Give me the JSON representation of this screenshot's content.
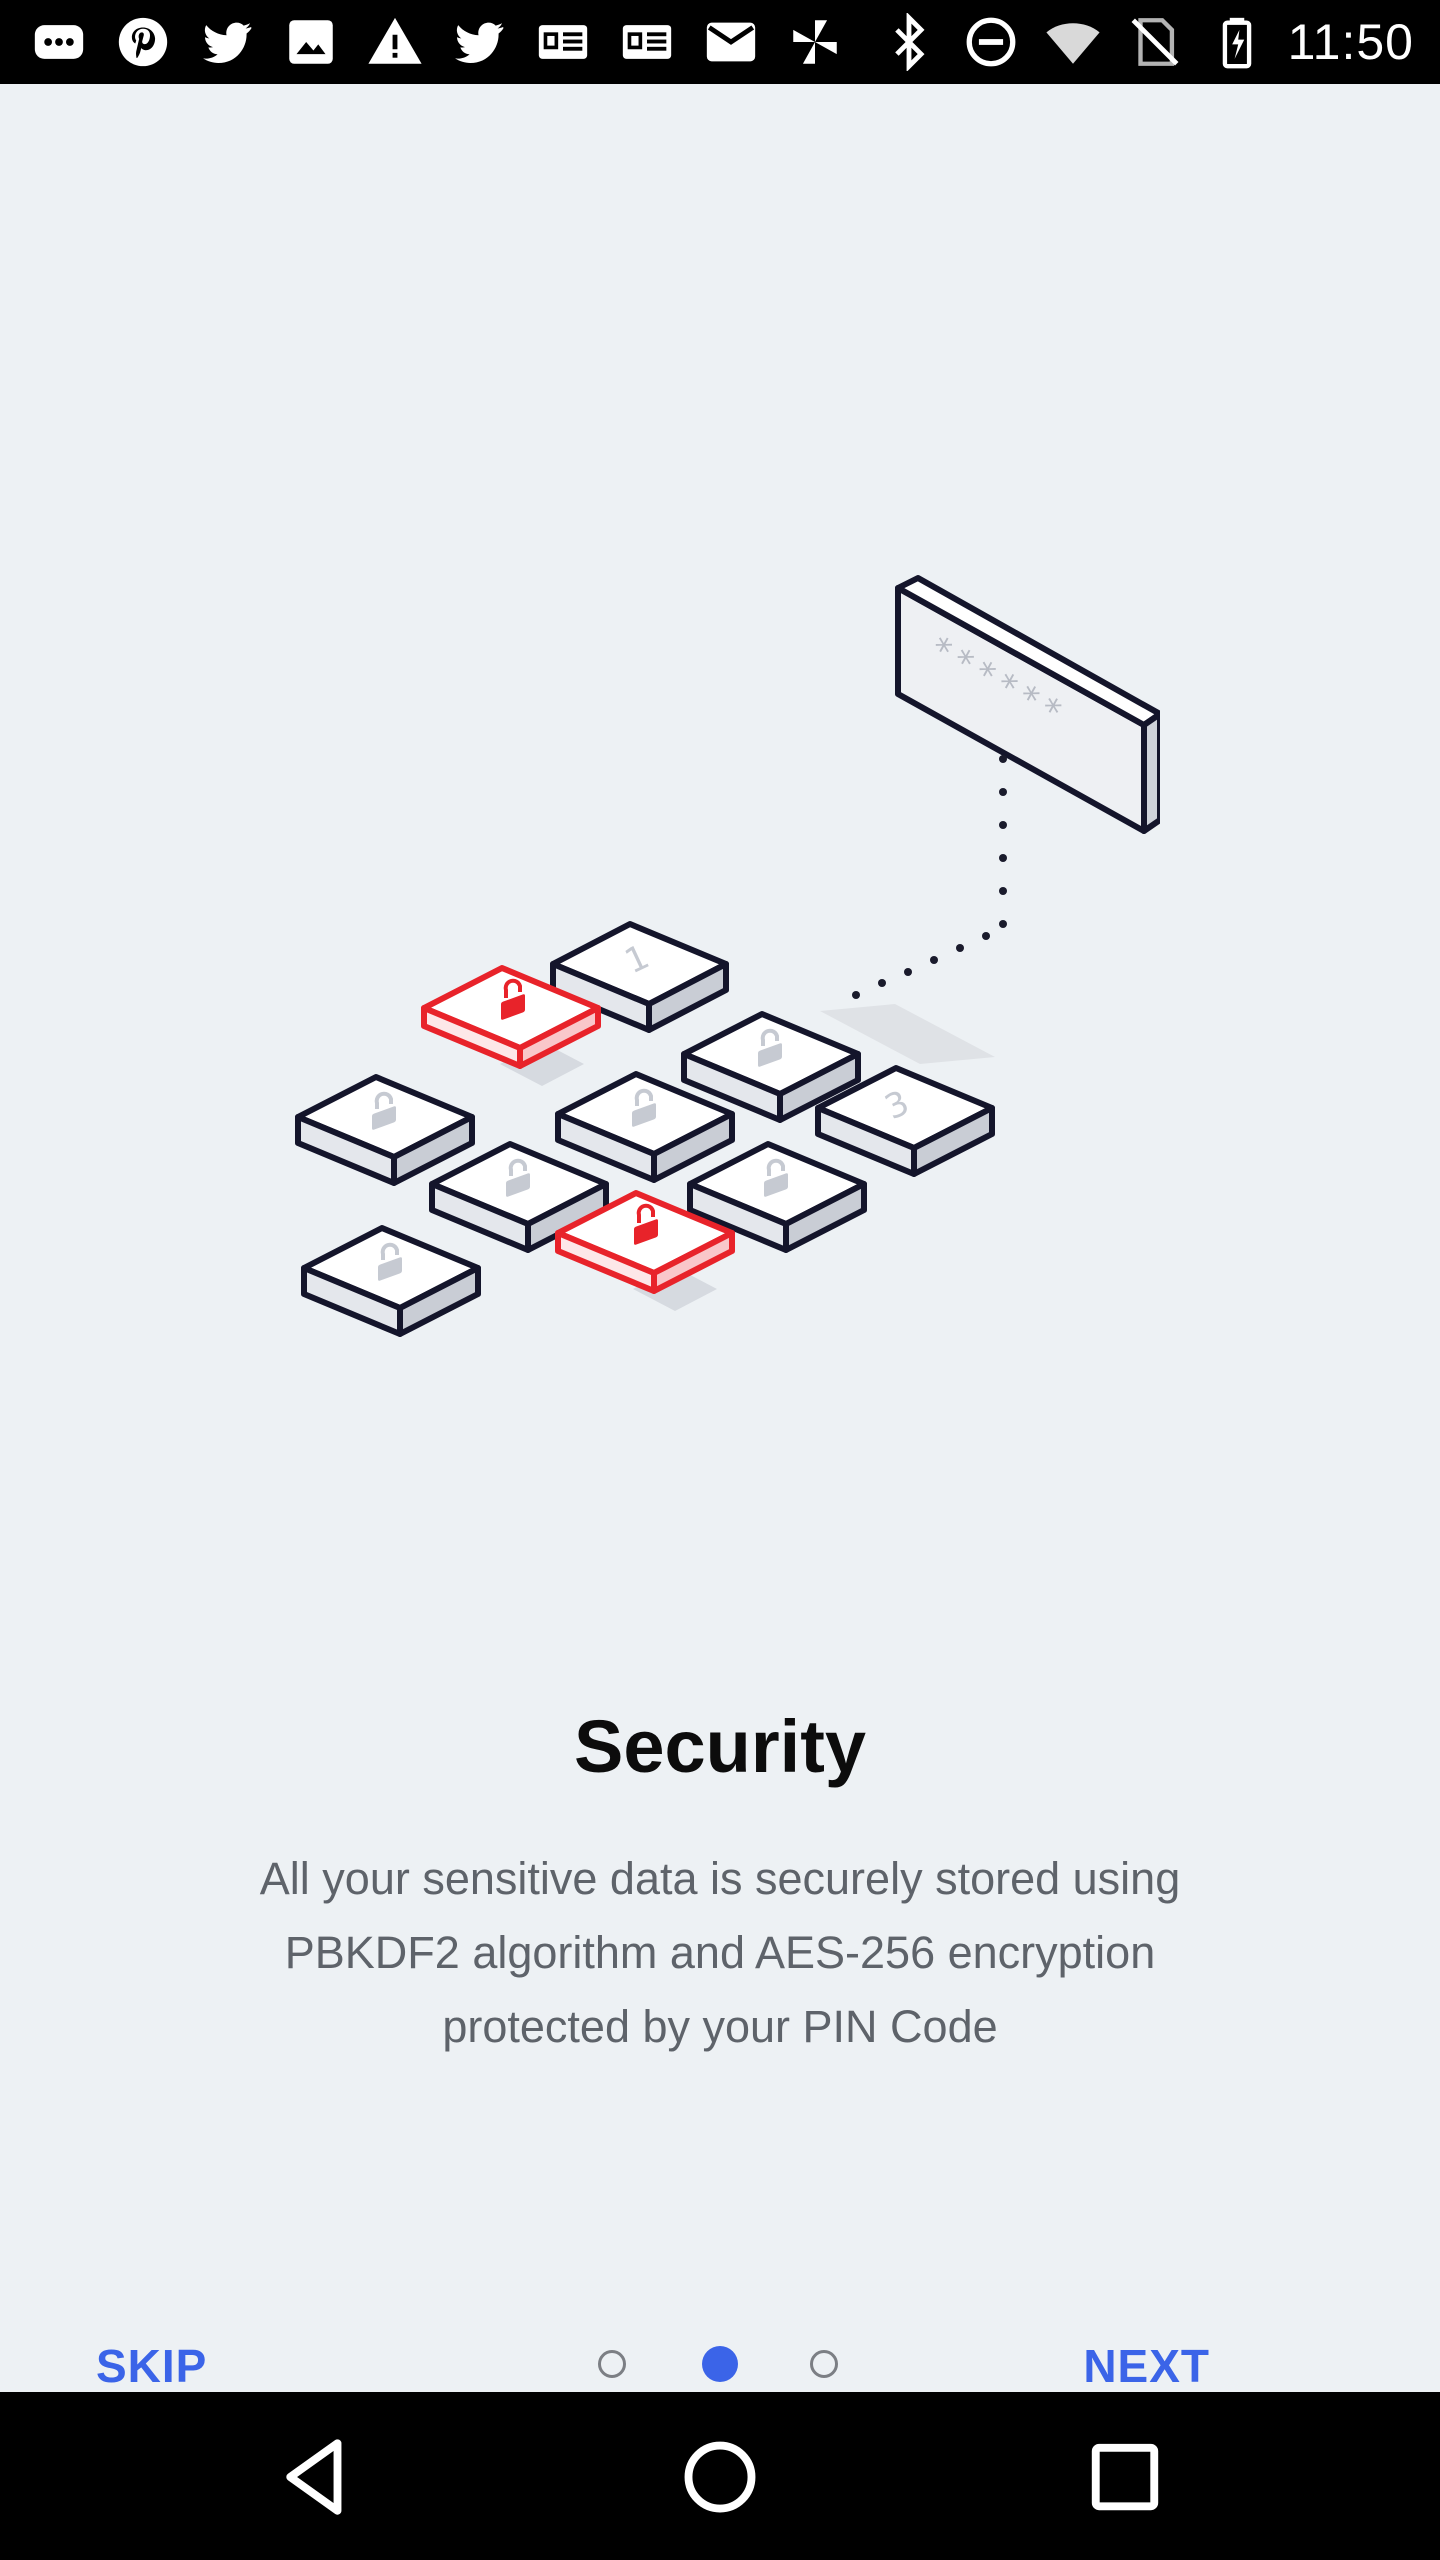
{
  "status_bar": {
    "time": "11:50",
    "left_icons": [
      "chat-icon",
      "pinterest-icon",
      "twitter-icon",
      "image-icon",
      "warning-icon",
      "twitter-icon",
      "news-icon",
      "news-icon",
      "mail-icon",
      "pinwheel-icon"
    ],
    "right_icons": [
      "bluetooth-icon",
      "do-not-disturb-icon",
      "wifi-icon",
      "no-sim-icon",
      "battery-icon"
    ]
  },
  "onboarding": {
    "title": "Security",
    "description": "All your sensitive data is securely stored using PBKDF2 algorithm and AES-256 encryption protected by your PIN Code",
    "skip_label": "SKIP",
    "next_label": "NEXT",
    "page_count": 3,
    "current_page": 2,
    "accent_color": "#3b64e8",
    "highlight_color": "#e8232a"
  },
  "illustration": {
    "password_mask": "******",
    "tile_labels": [
      "1",
      "3"
    ]
  },
  "nav_bar": {
    "icons": [
      "back-icon",
      "home-icon",
      "recents-icon"
    ]
  }
}
